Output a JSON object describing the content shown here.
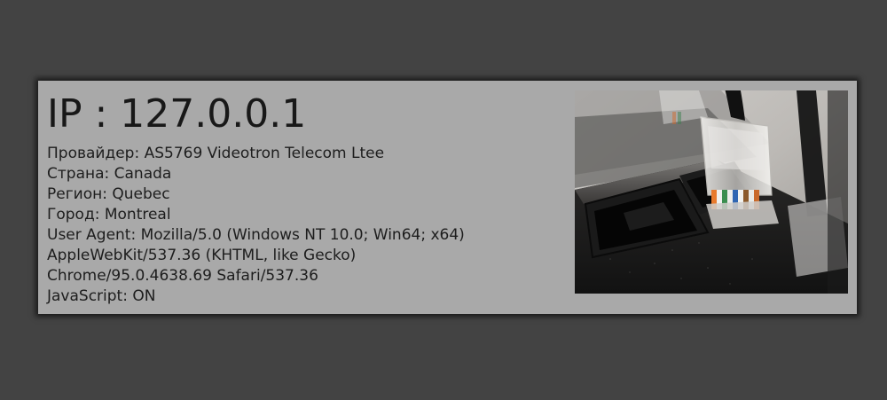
{
  "card": {
    "title": "IP : 127.0.0.1",
    "lines": [
      "Провайдер: AS5769 Videotron Telecom Ltee",
      "Страна: Canada",
      "Регион: Quebec",
      "Город: Montreal",
      "User Agent: Mozilla/5.0 (Windows NT 10.0; Win64; x64)",
      "AppleWebKit/537.36 (KHTML, like Gecko)",
      "Chrome/95.0.4638.69 Safari/537.36",
      "JavaScript: ON"
    ]
  },
  "colors": {
    "page_background": "#434343",
    "card_background": "#a9a9a9",
    "text": "#1d1d1d"
  },
  "image": {
    "subject": "network-cable-ports-photo"
  }
}
